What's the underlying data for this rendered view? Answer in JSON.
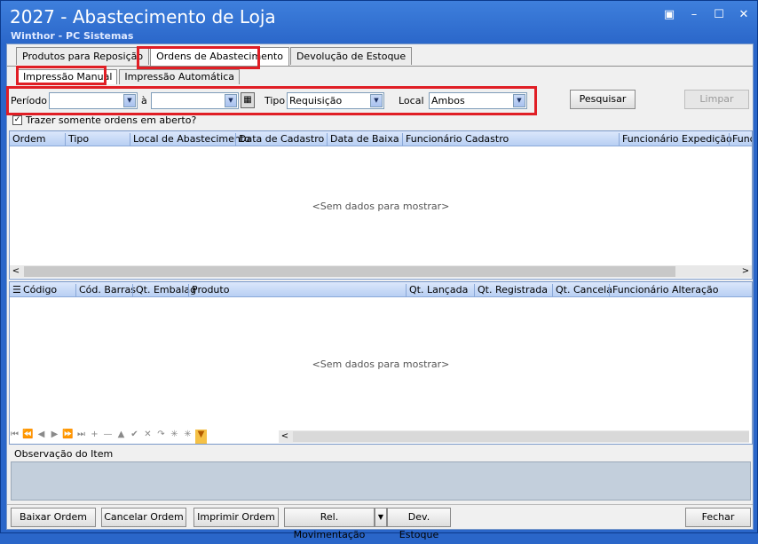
{
  "window": {
    "title": "2027 - Abastecimento de Loja",
    "subtitle": "Winthor - PC Sistemas",
    "controls": [
      "▣",
      "–",
      "☐",
      "✕"
    ]
  },
  "tabs_main": [
    {
      "label": "Produtos para Reposição"
    },
    {
      "label": "Ordens de Abastecimento"
    },
    {
      "label": "Devolução de Estoque"
    }
  ],
  "tabs_sub": [
    {
      "label": "Impressão Manual"
    },
    {
      "label": "Impressão Automática"
    }
  ],
  "filter": {
    "periodo_label": "Período",
    "a_label": "à",
    "periodo_de": "",
    "periodo_ate": "",
    "tipo_label": "Tipo",
    "tipo_value": "Requisição",
    "local_label": "Local",
    "local_value": "Ambos",
    "pesquisar": "Pesquisar",
    "limpar": "Limpar",
    "checkbox_label": "Trazer somente ordens em aberto?"
  },
  "grid_top": {
    "columns": [
      "Ordem",
      "Tipo",
      "Local de Abastecimento",
      "Data de Cadastro",
      "Data de Baixa",
      "Funcionário Cadastro",
      "Funcionário Expedição",
      "Func"
    ],
    "empty": "<Sem dados para mostrar>"
  },
  "grid_bottom": {
    "columns": [
      "Código",
      "Cód. Barras",
      "Qt. Embalag",
      "Produto",
      "Qt. Lançada",
      "Qt. Registrada",
      "Qt. Cancela",
      "Funcionário Alteração"
    ],
    "empty": "<Sem dados para mostrar>"
  },
  "navigator": [
    "⏮",
    "⏪",
    "◀",
    "▶",
    "⏩",
    "⏭",
    "+",
    "—",
    "▲",
    "✔",
    "✕",
    "↷",
    "✳",
    "✳",
    "▼"
  ],
  "obs_label": "Observação do Item",
  "buttons": {
    "baixar": "Baixar Ordem",
    "cancelar": "Cancelar Ordem",
    "imprimir": "Imprimir Ordem",
    "rel_mov": "Rel. Movimentação",
    "dev_estoque": "Dev. Estoque",
    "fechar": "Fechar"
  },
  "colors": {
    "title_bar": "#2a66c9",
    "highlight_box": "#e01e25",
    "grid_header": "#c7daf6"
  }
}
